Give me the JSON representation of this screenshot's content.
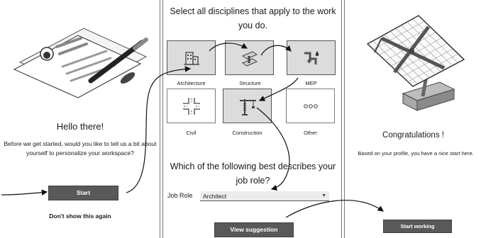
{
  "welcome": {
    "heading": "Hello there!",
    "intro": "Before we get started, would you like to tell us a bit about yourself to personalize your workspace?",
    "start_label": "Start",
    "dont_show_label": "Don't show this again"
  },
  "disciplines": {
    "title": "Select all disciplines that apply to the work you do.",
    "tiles": [
      {
        "label": "Architecture",
        "icon": "building-icon",
        "selected": true
      },
      {
        "label": "Structure",
        "icon": "steel-beam-icon",
        "selected": true
      },
      {
        "label": "MEP",
        "icon": "pipe-icon",
        "selected": true
      },
      {
        "label": "Civil",
        "icon": "road-intersection-icon",
        "selected": false
      },
      {
        "label": "Construction",
        "icon": "crane-icon",
        "selected": true
      },
      {
        "label": "Other",
        "icon": "more-dots-icon",
        "selected": false
      }
    ],
    "question": "Which of the following best describes your job role?",
    "job_role_label": "Job Role",
    "job_role_value": "Architect",
    "view_suggestion_label": "View suggestion"
  },
  "finish": {
    "heading": "Congratulations !",
    "message": "Based on your profile, you have a nice start here.",
    "start_working_label": "Start working"
  }
}
